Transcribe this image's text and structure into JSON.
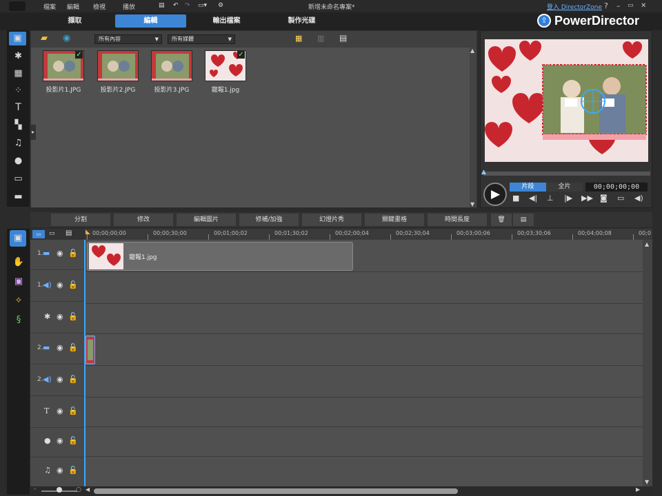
{
  "menu": {
    "items": [
      "檔案",
      "編輯",
      "檢視",
      "播放"
    ],
    "project_title": "新增未命名專案*",
    "login_link": "登入 DirectorZone",
    "help": "?",
    "minimize": "–",
    "restore": "▭",
    "close": "✕"
  },
  "mode_tabs": [
    "擷取",
    "編輯",
    "輸出檔案",
    "製作光碟"
  ],
  "brand": "PowerDirector",
  "library": {
    "filter_content": "所有內容",
    "filter_media": "所有媒體",
    "items": [
      {
        "label": "投影片1.JPG",
        "checked": true
      },
      {
        "label": "投影片2.JPG",
        "checked": false
      },
      {
        "label": "投影片3.JPG",
        "checked": false
      },
      {
        "label": "寵報1.jpg",
        "checked": true
      }
    ]
  },
  "preview": {
    "mode_clip": "片段",
    "mode_full": "全片",
    "timecode": "00;00;00;00"
  },
  "edit_buttons": [
    "分割",
    "修改",
    "編輯圖片",
    "修補/加強",
    "幻燈片秀",
    "關鍵畫格",
    "時間長度"
  ],
  "ruler_ticks": [
    "00;00;00;00",
    "00;00;30;00",
    "00;01;00;02",
    "00;01;30;02",
    "00;02;00;04",
    "00;02;30;04",
    "00;03;00;06",
    "00;03;30;06",
    "00;04;00;08",
    "00;0"
  ],
  "tracks": {
    "video1_index": "1.",
    "audio1_index": "1.",
    "video2_index": "2.",
    "audio2_index": "2.",
    "title_letter": "T",
    "clip_label": "寵報1.jpg"
  },
  "colors": {
    "accent": "#3d86d6",
    "heart_red": "#c8262e",
    "bg": "#2b2b2b"
  }
}
